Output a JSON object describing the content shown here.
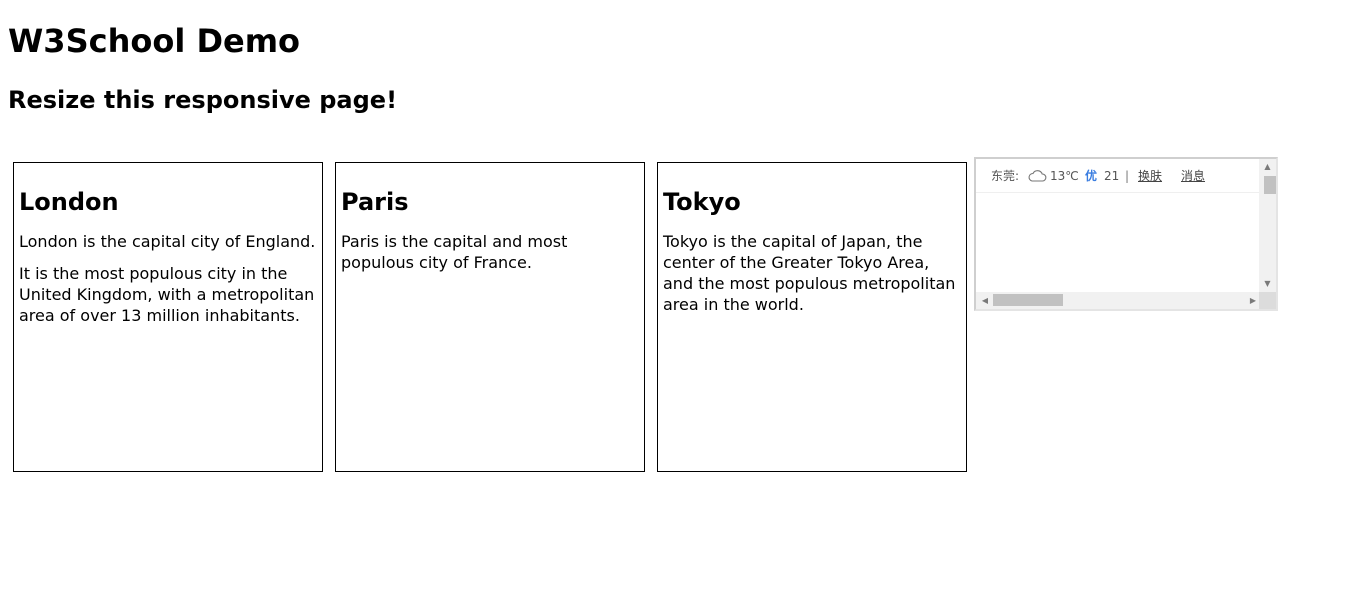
{
  "page": {
    "title": "W3School Demo",
    "subtitle": "Resize this responsive page!"
  },
  "cards": [
    {
      "city": "London",
      "paragraphs": [
        "London is the capital city of England.",
        "It is the most populous city in the United Kingdom, with a metropolitan area of over 13 million inhabitants."
      ]
    },
    {
      "city": "Paris",
      "paragraphs": [
        "Paris is the capital and most populous city of France."
      ]
    },
    {
      "city": "Tokyo",
      "paragraphs": [
        "Tokyo is the capital of Japan, the center of the Greater Tokyo Area, and the most populous metropolitan area in the world."
      ]
    }
  ],
  "weather_widget": {
    "city": "东莞:",
    "icon": "cloud-icon",
    "temperature": "13℃",
    "aqi_label": "优",
    "aqi_value": "21",
    "separator": "|",
    "skin_link": "换肤",
    "message_link": "消息",
    "colors": {
      "aqi": "#3a7de0",
      "scrollbar_track": "#f1f1f1",
      "scrollbar_thumb": "#c1c1c1"
    }
  }
}
